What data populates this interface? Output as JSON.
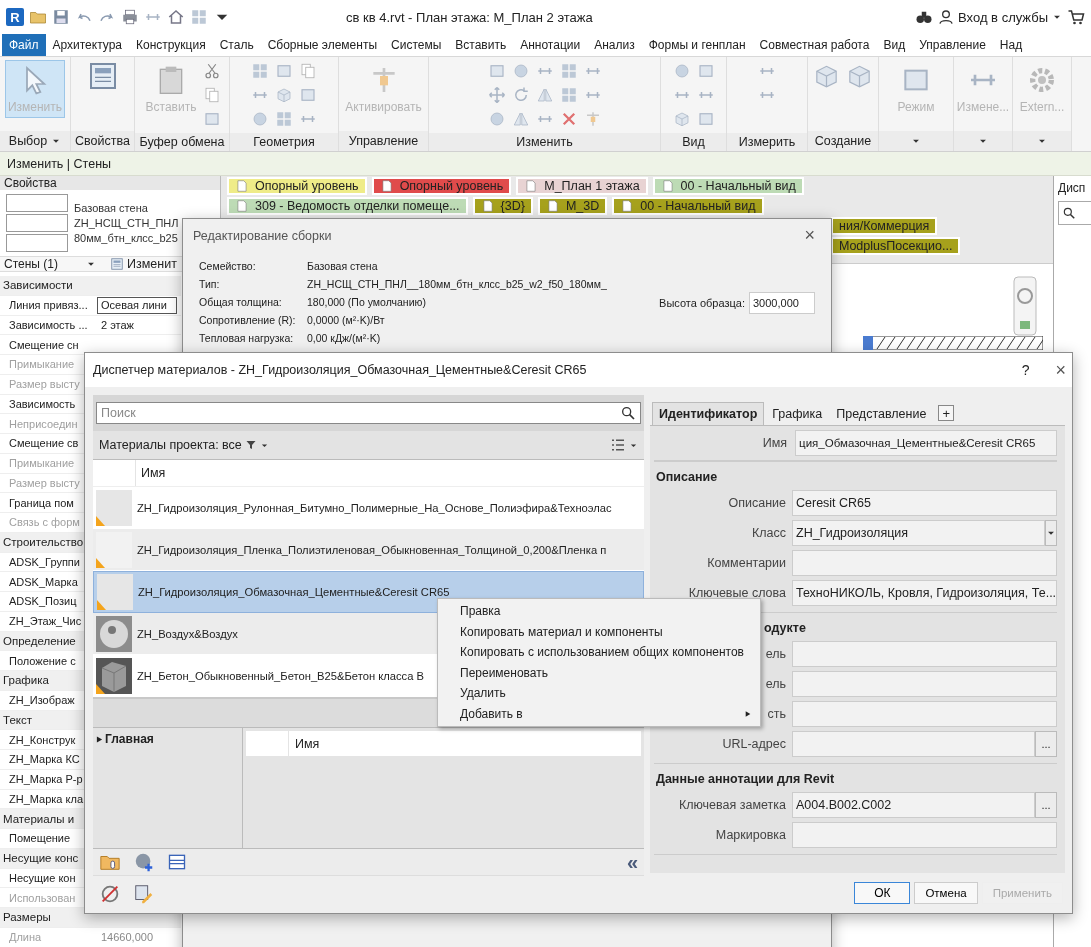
{
  "title_bar": {
    "logo": "R",
    "title": "св кв 4.rvt - План этажа: М_План 2 этажа",
    "account": "Вход в службы"
  },
  "ribbon_tabs": [
    {
      "label": "Файл",
      "kind": "file"
    },
    {
      "label": "Архитектура",
      "kind": "tab"
    },
    {
      "label": "Конструкция",
      "kind": "tab"
    },
    {
      "label": "Сталь",
      "kind": "tab"
    },
    {
      "label": "Сборные элементы",
      "kind": "tab"
    },
    {
      "label": "Системы",
      "kind": "tab"
    },
    {
      "label": "Вставить",
      "kind": "tab"
    },
    {
      "label": "Аннотации",
      "kind": "tab"
    },
    {
      "label": "Анализ",
      "kind": "tab"
    },
    {
      "label": "Формы и генплан",
      "kind": "tab"
    },
    {
      "label": "Совместная работа",
      "kind": "tab"
    },
    {
      "label": "Вид",
      "kind": "tab"
    },
    {
      "label": "Управление",
      "kind": "tab"
    },
    {
      "label": "Над",
      "kind": "tab"
    }
  ],
  "ribbon_panels": [
    {
      "label": "Выбор",
      "menu": true,
      "buttons": [
        {
          "label": "Изменить",
          "selected": true
        }
      ]
    },
    {
      "label": "Свойства",
      "menu": false
    },
    {
      "label": "Буфер обмена",
      "menu": false,
      "buttons": [
        {
          "label": "Вставить",
          "selected": false
        }
      ]
    },
    {
      "label": "Геометрия",
      "menu": false
    },
    {
      "label": "Управление",
      "menu": false,
      "buttons": [
        {
          "label": "Активировать",
          "selected": false
        }
      ]
    },
    {
      "label": "Изменить",
      "menu": false
    },
    {
      "label": "Вид",
      "menu": false
    },
    {
      "label": "Измерить",
      "menu": false
    },
    {
      "label": "Создание",
      "menu": false
    },
    {
      "menu": true,
      "buttons": [
        {
          "label": "Режим",
          "selected": false
        }
      ]
    },
    {
      "menu": true,
      "buttons": [
        {
          "label": "Измене...",
          "selected": false
        }
      ]
    },
    {
      "menu": true,
      "buttons": [
        {
          "label": "Extern...",
          "selected": false
        }
      ]
    }
  ],
  "context_bar": "Изменить | Стены",
  "properties": {
    "title": "Свойства",
    "type_lines": [
      "Базовая стена",
      "ZH_НСЩ_СТН_ПНЛ",
      "80мм_бтн_клсс_b25"
    ],
    "selector": "Стены (1)",
    "edit_type": "Изменит",
    "rows": [
      {
        "kind": "group",
        "label": "Зависимости",
        "disabled": false
      },
      {
        "kind": "field",
        "label": "Линия привяз...",
        "value": "Осевая лини",
        "disabled": false
      },
      {
        "kind": "param",
        "label": "Зависимость ...",
        "value": "2 этаж",
        "disabled": false
      },
      {
        "kind": "param",
        "label": "Смещение сн",
        "disabled": false
      },
      {
        "kind": "param",
        "label": "Примыкание",
        "disabled": true
      },
      {
        "kind": "param",
        "label": "Размер высту",
        "disabled": true
      },
      {
        "kind": "param",
        "label": "Зависимость",
        "disabled": false
      },
      {
        "kind": "param",
        "label": "Неприсоедин",
        "disabled": true
      },
      {
        "kind": "param",
        "label": "Смещение св",
        "disabled": false
      },
      {
        "kind": "param",
        "label": "Примыкание",
        "disabled": true
      },
      {
        "kind": "param",
        "label": "Размер высту",
        "disabled": true
      },
      {
        "kind": "param",
        "label": "Граница пом",
        "disabled": false
      },
      {
        "kind": "param",
        "label": "Связь с форм",
        "disabled": true
      },
      {
        "kind": "group",
        "label": "Строительство",
        "disabled": false
      },
      {
        "kind": "param",
        "label": "ADSK_Группи",
        "disabled": false
      },
      {
        "kind": "param",
        "label": "ADSK_Марка",
        "disabled": false
      },
      {
        "kind": "param",
        "label": "ADSK_Позиц",
        "disabled": false
      },
      {
        "kind": "param",
        "label": "ZH_Этаж_Чис",
        "disabled": false
      },
      {
        "kind": "group",
        "label": "Определение",
        "disabled": false
      },
      {
        "kind": "param",
        "label": "Положение с",
        "disabled": false
      },
      {
        "kind": "group",
        "label": "Графика",
        "disabled": false
      },
      {
        "kind": "param",
        "label": "ZH_Изображ",
        "disabled": false
      },
      {
        "kind": "group",
        "label": "Текст",
        "disabled": false
      },
      {
        "kind": "param",
        "label": "ZH_Конструк",
        "disabled": false
      },
      {
        "kind": "param",
        "label": "ZH_Марка КС",
        "disabled": false
      },
      {
        "kind": "param",
        "label": "ZH_Марка Р-р",
        "disabled": false
      },
      {
        "kind": "param",
        "label": "ZH_Марка кла",
        "disabled": false
      },
      {
        "kind": "group",
        "label": "Материалы и",
        "disabled": false
      },
      {
        "kind": "param",
        "label": "Помещение",
        "disabled": false
      },
      {
        "kind": "group",
        "label": "Несущие конс",
        "disabled": false
      },
      {
        "kind": "param",
        "label": "Несущие кон",
        "disabled": false
      },
      {
        "kind": "param",
        "label": "Использован",
        "disabled": true
      },
      {
        "kind": "group",
        "label": "Размеры",
        "disabled": false
      },
      {
        "kind": "param",
        "label": "Длина",
        "value": "14660,000",
        "disabled": true
      }
    ]
  },
  "view_tab_rows": [
    {
      "tabs": [
        {
          "label": "Опорный уровень",
          "color": "#efec88"
        },
        {
          "label": "Опорный уровень",
          "color": "#e04b4b"
        },
        {
          "label": "М_План 1 этажа",
          "color": "#e8d3d3"
        },
        {
          "label": "00 - Начальный вид",
          "color": "#bddbb5"
        }
      ]
    },
    {
      "tabs": [
        {
          "label": "309 - Ведомость отделки помеще...",
          "color": "#bddbb5"
        },
        {
          "label": "{3D}",
          "color": "#a6a11c"
        },
        {
          "label": "М_3D",
          "color": "#a6a11c"
        },
        {
          "label": "00 - Начальный вид",
          "color": "#a6a11c"
        }
      ]
    },
    {
      "tabs": [
        {
          "label": "ния/Коммерция",
          "color": "#a6a11c"
        }
      ]
    },
    {
      "tabs": [
        {
          "label": "ModplusПосекцио...",
          "color": "#a6a11c"
        }
      ]
    }
  ],
  "project_browser": {
    "title": "Дисп"
  },
  "assembly_dialog": {
    "title": "Редактирование сборки",
    "close": "×",
    "info": [
      {
        "label": "Семейство:",
        "value": "Базовая стена"
      },
      {
        "label": "Тип:",
        "value": "ZH_НСЩ_СТН_ПНЛ__180мм_бтн_клсс_b25_w2_f50_180мм_"
      },
      {
        "label": "Общая толщина:",
        "value": "180,000 (По умолчанию)"
      },
      {
        "label": "Сопротивление (R):",
        "value": "0,0000 (м²·K)/Вт"
      },
      {
        "label": "Тепловая нагрузка:",
        "value": "0,00 кДж/(м²·K)"
      }
    ],
    "sample_height": {
      "label": "Высота образца:",
      "value": "3000,000"
    }
  },
  "material_dialog": {
    "title": "Диспетчер материалов - ZH_Гидроизоляция_Обмазочная_Цементные&Ceresit CR65",
    "help": "?",
    "close": "×",
    "search": {
      "placeholder": "Поиск"
    },
    "filter_label": "Материалы проекта: все",
    "column": "Имя",
    "materials": [
      {
        "name": "ZH_Гидроизоляция_Рулонная_Битумно_Полимерные_На_Основе_Полиэфира&Техноэлас",
        "kind": "plain",
        "warning": true,
        "selected": false
      },
      {
        "name": "ZH_Гидроизоляция_Пленка_Полиэтиленовая_Обыкновенная_Толщиной_0,200&Пленка п",
        "kind": "light",
        "warning": true,
        "selected": false
      },
      {
        "name": "ZH_Гидроизоляция_Обмазочная_Цементные&Ceresit CR65",
        "kind": "plain",
        "warning": true,
        "selected": true
      },
      {
        "name": "ZH_Воздух&Воздух",
        "kind": "air",
        "warning": false,
        "selected": false
      },
      {
        "name": "ZH_Бетон_Обыкновенный_Бетон_B25&Бетон класса B",
        "kind": "concrete",
        "warning": true,
        "selected": false
      }
    ],
    "library": {
      "tree": [
        {
          "label": "Главная",
          "expanded": false
        }
      ],
      "column": "Имя"
    },
    "collapse": "«",
    "tabs": [
      {
        "label": "Идентификатор",
        "selected": true
      },
      {
        "label": "Графика",
        "selected": false
      },
      {
        "label": "Представление",
        "selected": false
      }
    ],
    "add_tab": "+",
    "name_field": {
      "label": "Имя",
      "value": "ция_Обмазочная_Цементные&Ceresit CR65"
    },
    "sections": [
      {
        "title": "Описание",
        "fields": [
          {
            "label": "Описание",
            "value": "Ceresit CR65",
            "kind": "text"
          },
          {
            "label": "Класс",
            "value": "ZH_Гидроизоляция",
            "kind": "dropdown"
          },
          {
            "label": "Комментарии",
            "kind": "text"
          },
          {
            "label": "Ключевые слова",
            "value": "ТехноНИКОЛЬ, Кровля, Гидроизоляция, Те...",
            "kind": "text"
          }
        ]
      },
      {
        "title": "одукте",
        "fields": [
          {
            "label": "ель",
            "kind": "text"
          },
          {
            "label": "ель",
            "kind": "text"
          },
          {
            "label": "сть",
            "kind": "text"
          },
          {
            "label": "URL-адрес",
            "kind": "browse",
            "browse": "..."
          }
        ]
      },
      {
        "title": "Данные аннотации для Revit",
        "fields": [
          {
            "label": "Ключевая заметка",
            "value": "A004.B002.C002",
            "kind": "browse",
            "browse": "..."
          },
          {
            "label": "Маркировка",
            "kind": "text"
          }
        ]
      }
    ],
    "buttons": [
      {
        "label": "ОК",
        "kind": "default"
      },
      {
        "label": "Отмена",
        "kind": "normal"
      },
      {
        "label": "Применить",
        "kind": "disabled"
      }
    ]
  },
  "context_menu": [
    {
      "label": "Правка",
      "submenu": false
    },
    {
      "label": "Копировать материал и компоненты",
      "submenu": false
    },
    {
      "label": "Копировать с использованием общих компонентов",
      "submenu": false
    },
    {
      "label": "Переименовать",
      "submenu": false
    },
    {
      "label": "Удалить",
      "submenu": false
    },
    {
      "label": "Добавить в",
      "submenu": true
    }
  ]
}
